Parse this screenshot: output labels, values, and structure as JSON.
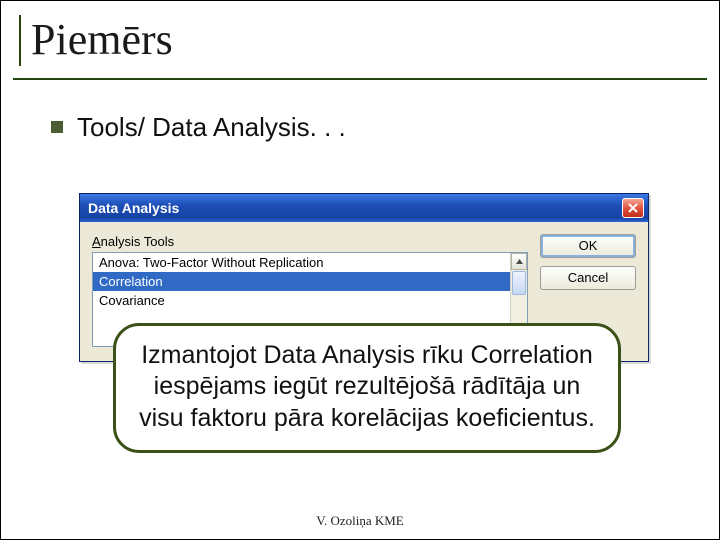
{
  "slide": {
    "title": "Piemērs",
    "bullet": "Tools/ Data Analysis. . .",
    "footer": "V. Ozoliņa KME"
  },
  "dialog": {
    "title": "Data Analysis",
    "label_prefix": "A",
    "label_rest": "nalysis Tools",
    "items": [
      "Anova: Two-Factor Without Replication",
      "Correlation",
      "Covariance"
    ],
    "selected_index": 1,
    "ok": "OK",
    "cancel": "Cancel"
  },
  "callout": {
    "text": "Izmantojot Data Analysis rīku Correlation iespējams iegūt rezultējošā rādītāja un visu faktoru pāra korelācijas koeficientus."
  }
}
